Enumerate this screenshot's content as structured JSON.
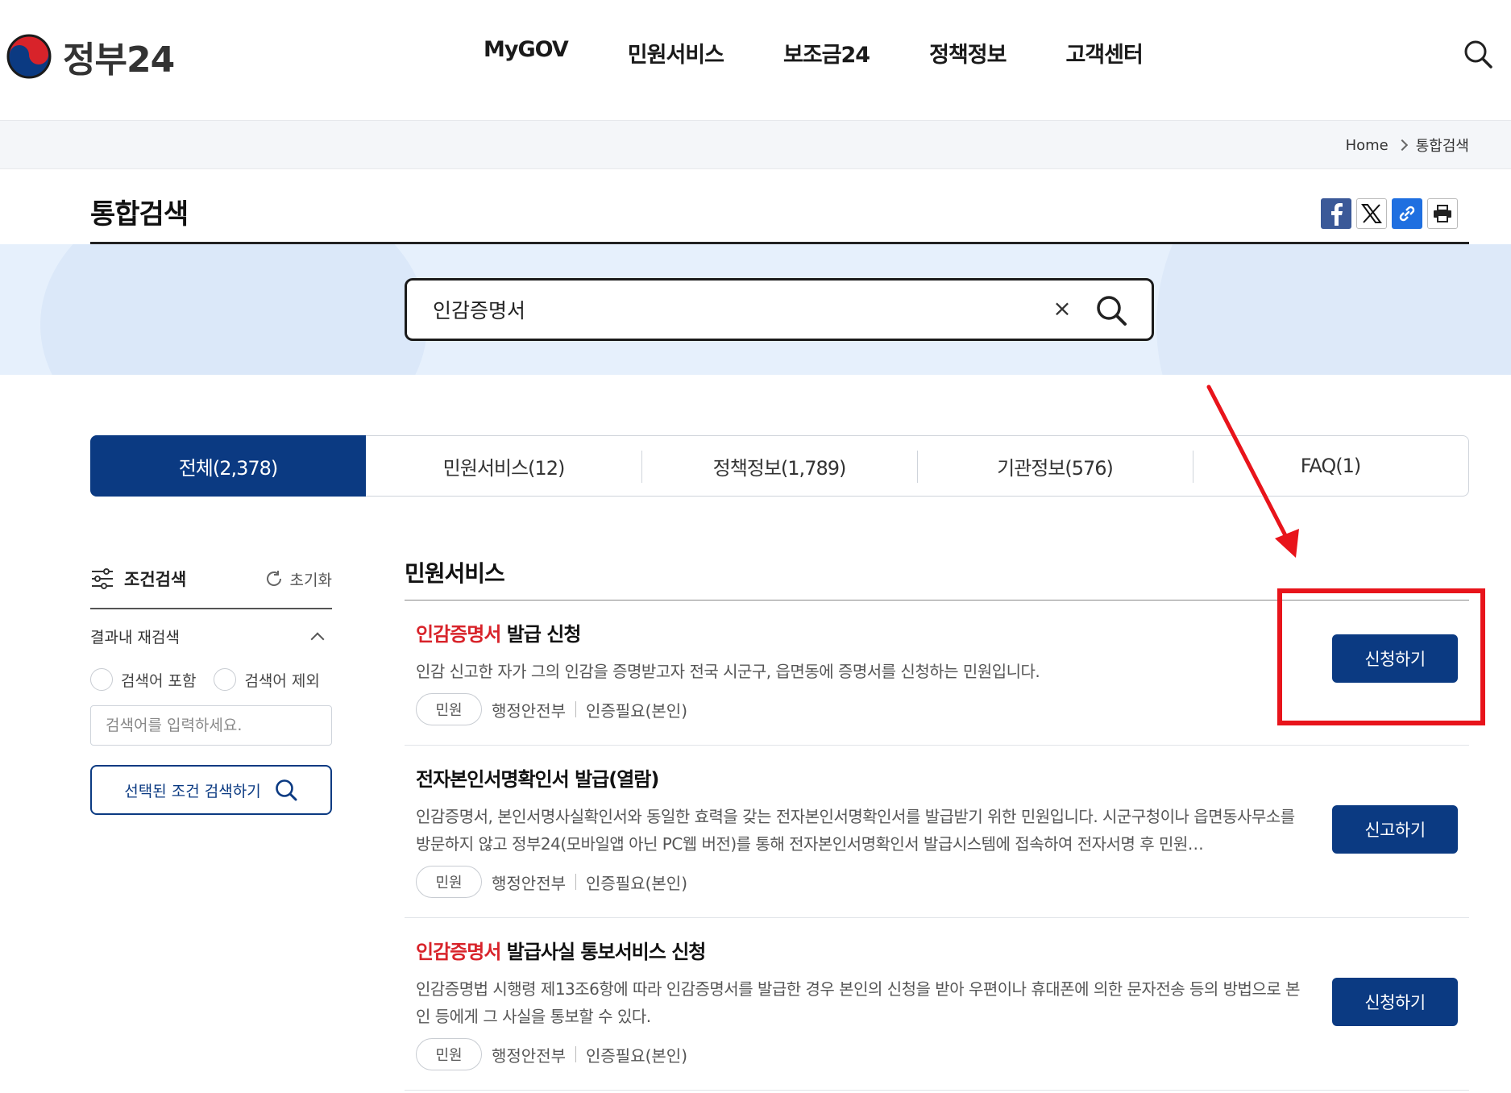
{
  "header": {
    "logo_text": "정부24",
    "nav": [
      "MyGOV",
      "민원서비스",
      "보조금24",
      "정책정보",
      "고객센터"
    ]
  },
  "breadcrumb": {
    "home": "Home",
    "current": "통합검색"
  },
  "page": {
    "title": "통합검색"
  },
  "search": {
    "query": "인감증명서",
    "clear_label": "×"
  },
  "tabs": [
    {
      "label": "전체(2,378)",
      "active": true
    },
    {
      "label": "민원서비스(12)",
      "active": false
    },
    {
      "label": "정책정보(1,789)",
      "active": false
    },
    {
      "label": "기관정보(576)",
      "active": false
    },
    {
      "label": "FAQ(1)",
      "active": false
    }
  ],
  "filter": {
    "title": "조건검색",
    "reset": "초기화",
    "refine_title": "결과내 재검색",
    "include": "검색어 포함",
    "exclude": "검색어 제외",
    "input_placeholder": "검색어를 입력하세요.",
    "submit": "선택된 조건 검색하기"
  },
  "results": {
    "section_title": "민원서비스",
    "items": [
      {
        "title_hl": "인감증명서",
        "title_rest": " 발급 신청",
        "desc": "인감 신고한 자가 그의 인감을 증명받고자 전국 시군구, 읍면동에 증명서를 신청하는 민원입니다.",
        "tag": "민원",
        "agency": "행정안전부",
        "auth": "인증필요(본인)",
        "action": "신청하기"
      },
      {
        "title_hl": "",
        "title_rest": "전자본인서명확인서 발급(열람)",
        "desc": "인감증명서, 본인서명사실확인서와 동일한 효력을 갖는 전자본인서명확인서를 발급받기 위한 민원입니다. 시군구청이나 읍면동사무소를 방문하지 않고 정부24(모바일앱 아닌 PC웹 버전)를 통해 전자본인서명확인서 발급시스템에 접속하여 전자서명 후 민원…",
        "tag": "민원",
        "agency": "행정안전부",
        "auth": "인증필요(본인)",
        "action": "신고하기"
      },
      {
        "title_hl": "인감증명서",
        "title_rest": " 발급사실 통보서비스 신청",
        "desc": "인감증명법 시행령 제13조6항에 따라 인감증명서를 발급한 경우 본인의 신청을 받아 우편이나 휴대폰에 의한 문자전송 등의 방법으로 본인 등에게 그 사실을 통보할 수 있다.",
        "tag": "민원",
        "agency": "행정안전부",
        "auth": "인증필요(본인)",
        "action": "신청하기"
      }
    ]
  },
  "colors": {
    "primary": "#0b3a82",
    "highlight": "#d8232a",
    "annotation": "#e8141b",
    "hero_bg": "#e6f0fc"
  }
}
